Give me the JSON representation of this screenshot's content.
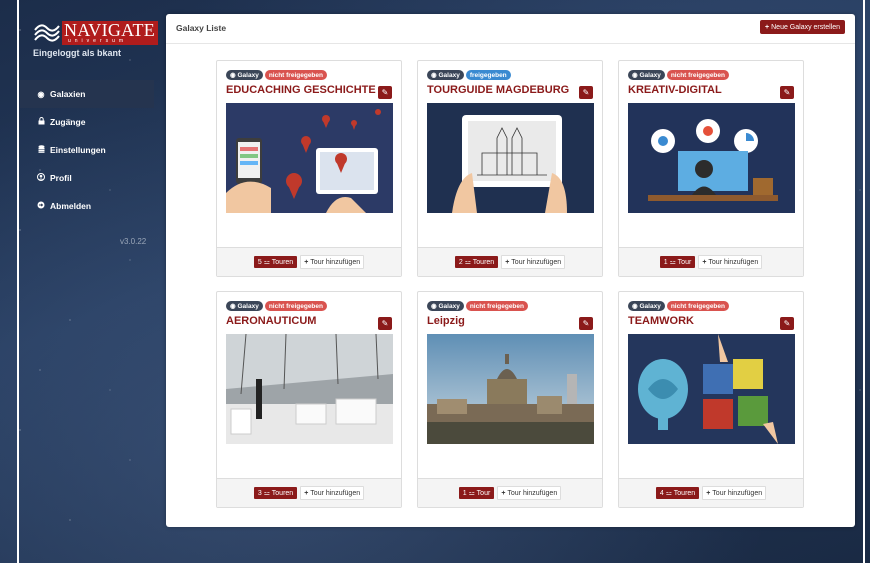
{
  "brand": {
    "title": "NAVIGATE",
    "subtitle": "universum",
    "logo_icon": "waves-logo-icon",
    "brand_color": "#b01c1c"
  },
  "user": {
    "logged_in_text": "Eingeloggt als bkant"
  },
  "sidebar": {
    "items": [
      {
        "label": "Galaxien",
        "icon": "target-icon",
        "active": true
      },
      {
        "label": "Zugänge",
        "icon": "lock-icon",
        "active": false
      },
      {
        "label": "Einstellungen",
        "icon": "database-icon",
        "active": false
      },
      {
        "label": "Profil",
        "icon": "user-circle-icon",
        "active": false
      },
      {
        "label": "Abmelden",
        "icon": "logout-icon",
        "active": false
      }
    ],
    "version": "v3.0.22"
  },
  "panel": {
    "title": "Galaxy Liste",
    "new_button_label": "Neue Galaxy erstellen"
  },
  "cards": [
    {
      "type_badge": "Galaxy",
      "status": "nicht freigegeben",
      "status_color": "#d9534f",
      "title": "EDUCACHING GESCHICHTE",
      "tours_label": "5 ⚍ Touren",
      "add_label": "Tour hinzufügen",
      "image": "map-tablet-illustration"
    },
    {
      "type_badge": "Galaxy",
      "status": "freigegeben",
      "status_color": "#3a8ad1",
      "title": "TOURGUIDE MAGDEBURG",
      "tours_label": "2 ⚍ Touren",
      "add_label": "Tour hinzufügen",
      "image": "tablet-cathedral-sketch"
    },
    {
      "type_badge": "Galaxy",
      "status": "nicht freigegeben",
      "status_color": "#d9534f",
      "title": "KREATIV-DIGITAL",
      "tours_label": "1 ⚍ Tour",
      "add_label": "Tour hinzufügen",
      "image": "person-at-computer-illustration"
    },
    {
      "type_badge": "Galaxy",
      "status": "nicht freigegeben",
      "status_color": "#d9534f",
      "title": "AERONAUTICUM",
      "tours_label": "3 ⚍ Touren",
      "add_label": "Tour hinzufügen",
      "image": "museum-hall-photo"
    },
    {
      "type_badge": "Galaxy",
      "status": "nicht freigegeben",
      "status_color": "#d9534f",
      "title": "Leipzig",
      "tours_label": "1 ⚍ Tour",
      "add_label": "Tour hinzufügen",
      "image": "leipzig-skyline-photo"
    },
    {
      "type_badge": "Galaxy",
      "status": "nicht freigegeben",
      "status_color": "#d9534f",
      "title": "TEAMWORK",
      "tours_label": "4 ⚍ Touren",
      "add_label": "Tour hinzufügen",
      "image": "puzzle-hands-illustration"
    }
  ]
}
